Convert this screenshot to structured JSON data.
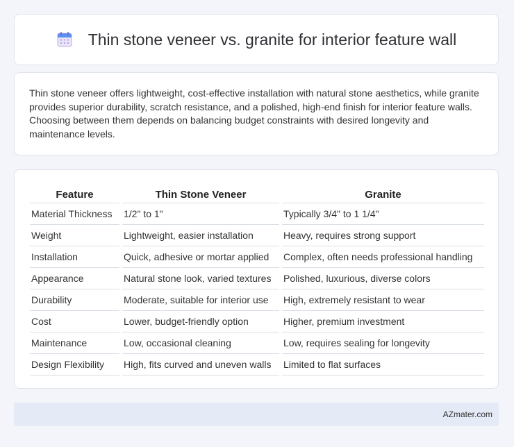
{
  "header": {
    "title": "Thin stone veneer vs. granite for interior feature wall",
    "icon": "calendar-icon"
  },
  "intro": {
    "text": "Thin stone veneer offers lightweight, cost-effective installation with natural stone aesthetics, while granite provides superior durability, scratch resistance, and a polished, high-end finish for interior feature walls. Choosing between them depends on balancing budget constraints with desired longevity and maintenance levels."
  },
  "table": {
    "headers": [
      "Feature",
      "Thin Stone Veneer",
      "Granite"
    ],
    "rows": [
      [
        "Material Thickness",
        "1/2\" to 1\"",
        "Typically 3/4\" to 1 1/4\""
      ],
      [
        "Weight",
        "Lightweight, easier installation",
        "Heavy, requires strong support"
      ],
      [
        "Installation",
        "Quick, adhesive or mortar applied",
        "Complex, often needs professional handling"
      ],
      [
        "Appearance",
        "Natural stone look, varied textures",
        "Polished, luxurious, diverse colors"
      ],
      [
        "Durability",
        "Moderate, suitable for interior use",
        "High, extremely resistant to wear"
      ],
      [
        "Cost",
        "Lower, budget-friendly option",
        "Higher, premium investment"
      ],
      [
        "Maintenance",
        "Low, occasional cleaning",
        "Low, requires sealing for longevity"
      ],
      [
        "Design Flexibility",
        "High, fits curved and uneven walls",
        "Limited to flat surfaces"
      ]
    ]
  },
  "footer": {
    "text": "AZmater.com"
  }
}
